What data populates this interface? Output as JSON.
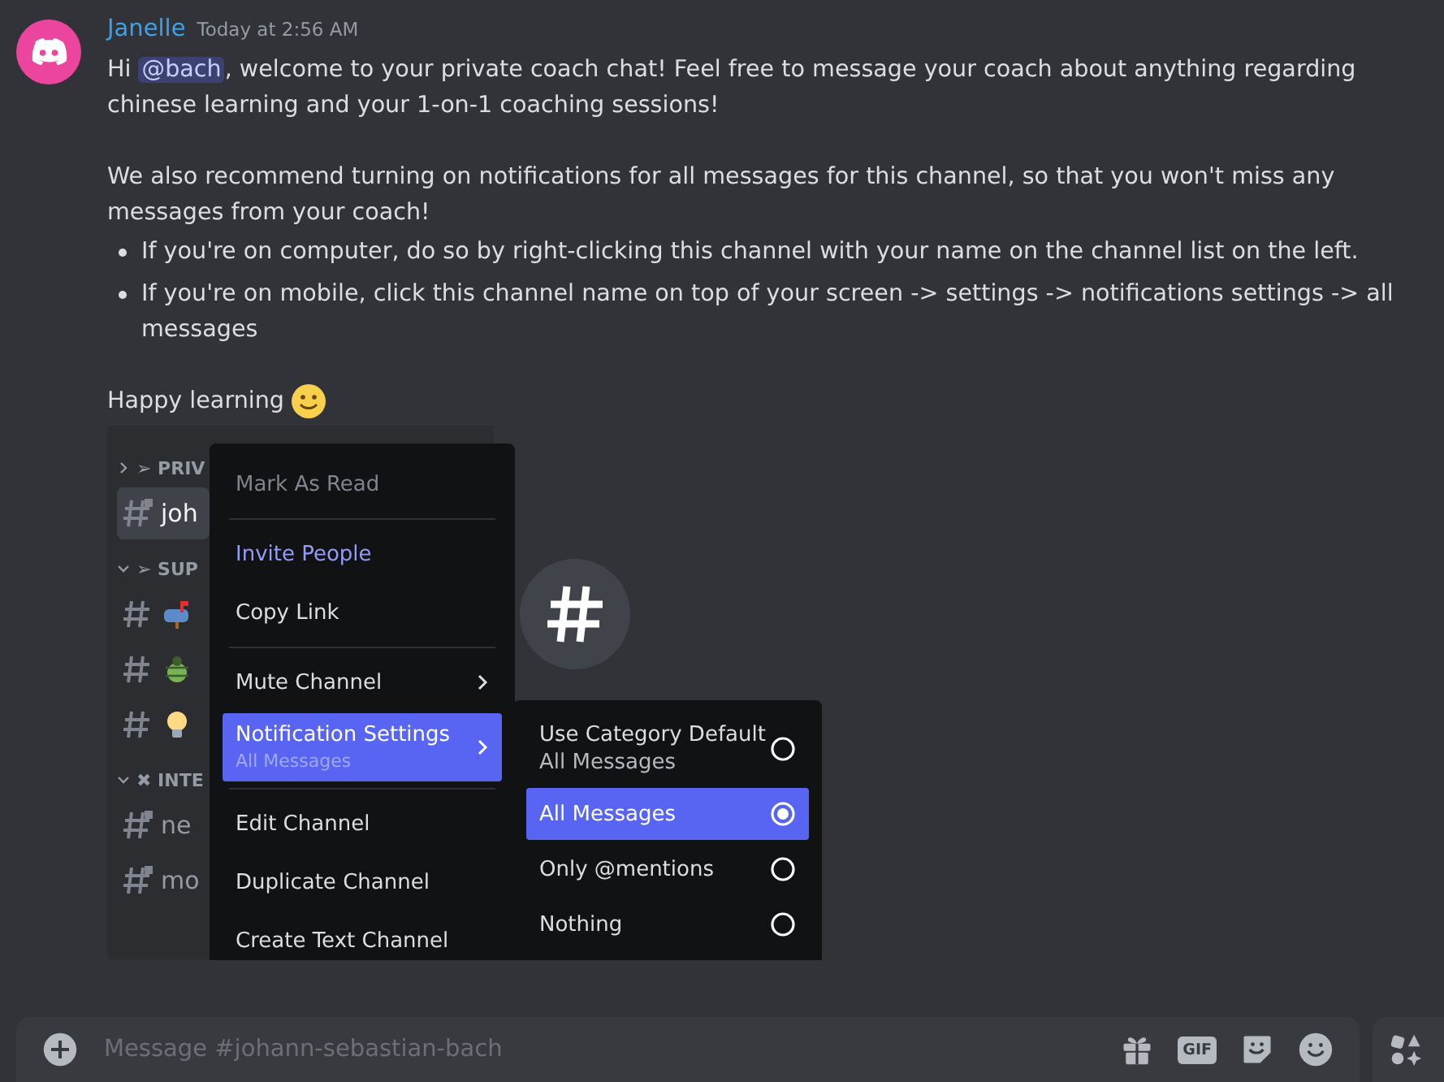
{
  "message": {
    "author": "Janelle",
    "timestamp": "Today at 2:56 AM",
    "intro": {
      "before": "Hi ",
      "mention": "@bach",
      "after": ", welcome to your private coach chat! Feel free to message your coach about anything regarding chinese learning and your 1-on-1 coaching sessions!"
    },
    "recommend": "We also recommend turning on notifications for all messages for this channel, so that you won't miss any messages from your coach!",
    "bullets": [
      "If you're on computer, do so by right-clicking this channel with your name on the channel list on the left.",
      "If you're on mobile, click this channel name on top of your screen -> settings -> notifications settings -> all messages"
    ],
    "closing": "Happy learning"
  },
  "embedded_screenshot": {
    "categories": [
      {
        "name": "➢ PRIV",
        "expanded": false,
        "channels": [
          {
            "name": "joh",
            "kind": "locked",
            "selected": true
          }
        ]
      },
      {
        "name": "➢ SUP",
        "expanded": true,
        "channels": [
          {
            "kind": "mailbox",
            "selected": false
          },
          {
            "kind": "bug",
            "selected": false
          },
          {
            "kind": "bulb",
            "selected": false
          }
        ]
      },
      {
        "name": "✖ INTE",
        "expanded": true,
        "channels": [
          {
            "name": "ne",
            "kind": "locked",
            "selected": false
          },
          {
            "name": "mo",
            "kind": "locked",
            "selected": false
          }
        ]
      }
    ],
    "context_menu": [
      [
        {
          "label": "Mark As Read",
          "kind": "plain",
          "disabled": true,
          "submenu": false,
          "selected": false
        }
      ],
      [
        {
          "label": "Invite People",
          "kind": "accent",
          "disabled": false,
          "submenu": false,
          "selected": false
        },
        {
          "label": "Copy Link",
          "kind": "plain",
          "disabled": false,
          "submenu": false,
          "selected": false
        }
      ],
      [
        {
          "label": "Mute Channel",
          "kind": "plain",
          "disabled": false,
          "submenu": true,
          "selected": false
        },
        {
          "label": "Notification Settings",
          "sublabel": "All Messages",
          "kind": "plain",
          "disabled": false,
          "submenu": true,
          "selected": true
        }
      ],
      [
        {
          "label": "Edit Channel",
          "kind": "plain",
          "disabled": false,
          "submenu": false,
          "selected": false
        },
        {
          "label": "Duplicate Channel",
          "kind": "plain",
          "disabled": false,
          "submenu": false,
          "selected": false
        },
        {
          "label": "Create Text Channel",
          "kind": "plain",
          "disabled": false,
          "submenu": false,
          "selected": false
        }
      ]
    ],
    "notification_submenu": [
      {
        "label": "Use Category Default",
        "sublabel": "All Messages",
        "selected": false
      },
      {
        "label": "All Messages",
        "selected": true
      },
      {
        "label": "Only @mentions",
        "selected": false
      },
      {
        "label": "Nothing",
        "selected": false
      }
    ]
  },
  "composer": {
    "placeholder": "Message #johann-sebastian-bach",
    "gif_label": "GIF"
  }
}
